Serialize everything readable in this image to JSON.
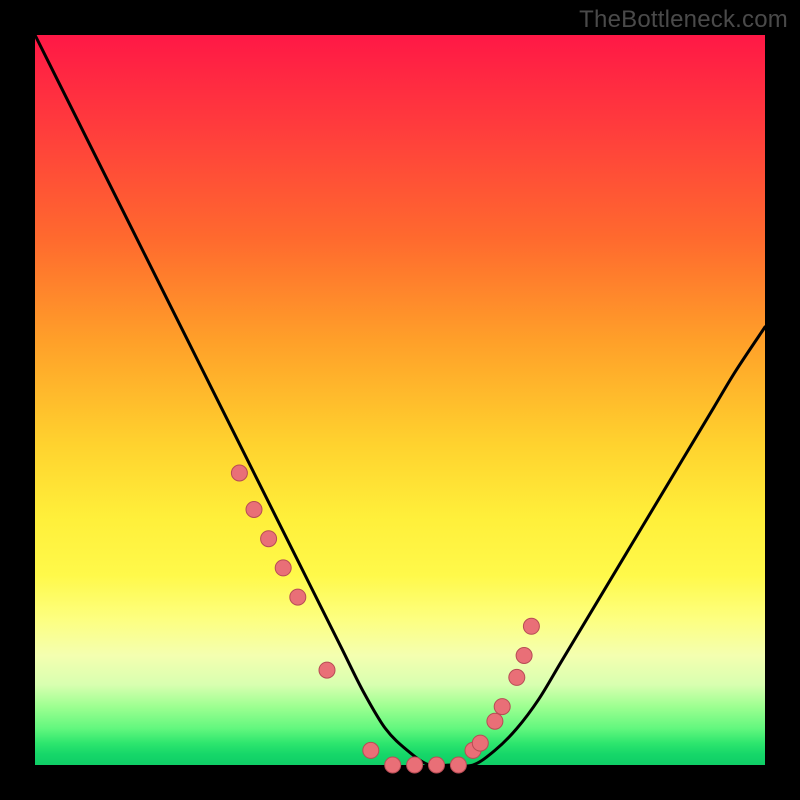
{
  "watermark": "TheBottleneck.com",
  "colors": {
    "frame": "#000000",
    "curve": "#000000",
    "dot_fill": "#e96f77",
    "dot_stroke": "#b74c55"
  },
  "chart_data": {
    "type": "line",
    "title": "",
    "xlabel": "",
    "ylabel": "",
    "xlim": [
      0,
      100
    ],
    "ylim": [
      0,
      100
    ],
    "grid": false,
    "legend": false,
    "series": [
      {
        "name": "bottleneck-curve",
        "x": [
          0,
          3,
          6,
          9,
          12,
          15,
          18,
          21,
          24,
          27,
          30,
          33,
          36,
          39,
          42,
          45,
          48,
          51,
          54,
          57,
          60,
          63,
          66,
          69,
          72,
          75,
          78,
          81,
          84,
          87,
          90,
          93,
          96,
          100
        ],
        "y": [
          100,
          94,
          88,
          82,
          76,
          70,
          64,
          58,
          52,
          46,
          40,
          34,
          28,
          22,
          16,
          10,
          5,
          2,
          0,
          0,
          0,
          2,
          5,
          9,
          14,
          19,
          24,
          29,
          34,
          39,
          44,
          49,
          54,
          60
        ]
      }
    ],
    "annotated_points": {
      "name": "highlighted-dots",
      "x": [
        28,
        30,
        32,
        34,
        36,
        40,
        46,
        49,
        52,
        55,
        58,
        60,
        61,
        63,
        64,
        66,
        67,
        68
      ],
      "y": [
        40,
        35,
        31,
        27,
        23,
        13,
        2,
        0,
        0,
        0,
        0,
        2,
        3,
        6,
        8,
        12,
        15,
        19
      ]
    }
  }
}
